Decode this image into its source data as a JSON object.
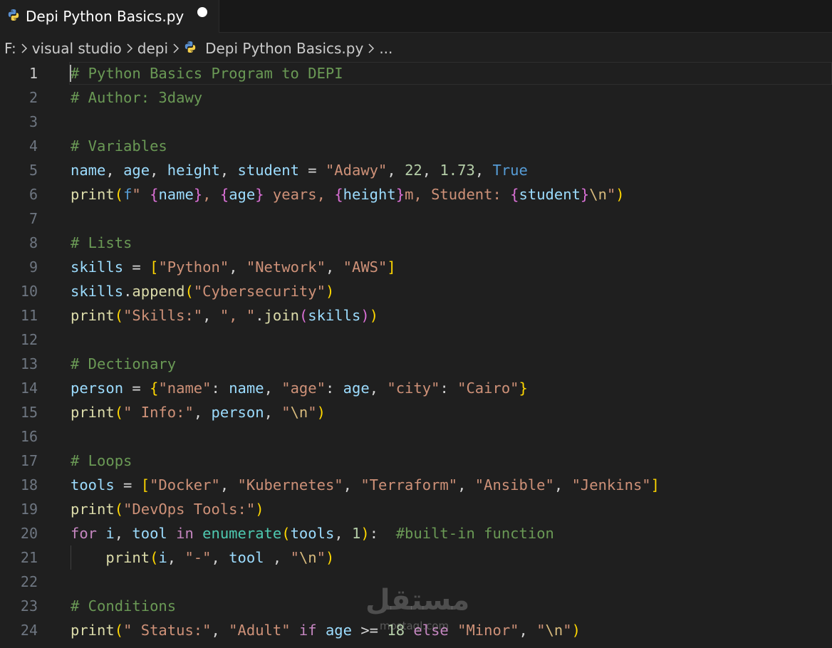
{
  "tab": {
    "label": "Depi Python Basics.py",
    "icon": "python-icon",
    "modified": true
  },
  "breadcrumb": {
    "drive": "F:",
    "folder1": "visual studio",
    "folder2": "depi",
    "file": "Depi Python Basics.py",
    "more": "..."
  },
  "editor": {
    "active_line": 1,
    "lines": [
      {
        "num": "1",
        "tokens": [
          {
            "t": "# Python Basics Program to DEPI",
            "c": "c"
          }
        ]
      },
      {
        "num": "2",
        "tokens": [
          {
            "t": "# Author: 3dawy",
            "c": "c"
          }
        ]
      },
      {
        "num": "3",
        "tokens": []
      },
      {
        "num": "4",
        "tokens": [
          {
            "t": "# Variables",
            "c": "c"
          }
        ]
      },
      {
        "num": "5",
        "tokens": [
          {
            "t": "name",
            "c": "v"
          },
          {
            "t": ", ",
            "c": "p"
          },
          {
            "t": "age",
            "c": "v"
          },
          {
            "t": ", ",
            "c": "p"
          },
          {
            "t": "height",
            "c": "v"
          },
          {
            "t": ", ",
            "c": "p"
          },
          {
            "t": "student",
            "c": "v"
          },
          {
            "t": " = ",
            "c": "p"
          },
          {
            "t": "\"Adawy\"",
            "c": "s"
          },
          {
            "t": ", ",
            "c": "p"
          },
          {
            "t": "22",
            "c": "n"
          },
          {
            "t": ", ",
            "c": "p"
          },
          {
            "t": "1.73",
            "c": "n"
          },
          {
            "t": ", ",
            "c": "p"
          },
          {
            "t": "True",
            "c": "k"
          }
        ]
      },
      {
        "num": "6",
        "tokens": [
          {
            "t": "print",
            "c": "f"
          },
          {
            "t": "(",
            "c": "b1"
          },
          {
            "t": "f",
            "c": "k"
          },
          {
            "t": "\" ",
            "c": "s"
          },
          {
            "t": "{",
            "c": "b2"
          },
          {
            "t": "name",
            "c": "v"
          },
          {
            "t": "}",
            "c": "b2"
          },
          {
            "t": ", ",
            "c": "s"
          },
          {
            "t": "{",
            "c": "b2"
          },
          {
            "t": "age",
            "c": "v"
          },
          {
            "t": "}",
            "c": "b2"
          },
          {
            "t": " years, ",
            "c": "s"
          },
          {
            "t": "{",
            "c": "b2"
          },
          {
            "t": "height",
            "c": "v"
          },
          {
            "t": "}",
            "c": "b2"
          },
          {
            "t": "m, Student: ",
            "c": "s"
          },
          {
            "t": "{",
            "c": "b2"
          },
          {
            "t": "student",
            "c": "v"
          },
          {
            "t": "}",
            "c": "b2"
          },
          {
            "t": "\\n",
            "c": "esc"
          },
          {
            "t": "\"",
            "c": "s"
          },
          {
            "t": ")",
            "c": "b1"
          }
        ]
      },
      {
        "num": "7",
        "tokens": []
      },
      {
        "num": "8",
        "tokens": [
          {
            "t": "# Lists",
            "c": "c"
          }
        ]
      },
      {
        "num": "9",
        "tokens": [
          {
            "t": "skills",
            "c": "v"
          },
          {
            "t": " = ",
            "c": "p"
          },
          {
            "t": "[",
            "c": "b1"
          },
          {
            "t": "\"Python\"",
            "c": "s"
          },
          {
            "t": ", ",
            "c": "p"
          },
          {
            "t": "\"Network\"",
            "c": "s"
          },
          {
            "t": ", ",
            "c": "p"
          },
          {
            "t": "\"AWS\"",
            "c": "s"
          },
          {
            "t": "]",
            "c": "b1"
          }
        ]
      },
      {
        "num": "10",
        "tokens": [
          {
            "t": "skills",
            "c": "v"
          },
          {
            "t": ".",
            "c": "p"
          },
          {
            "t": "append",
            "c": "f"
          },
          {
            "t": "(",
            "c": "b1"
          },
          {
            "t": "\"Cybersecurity\"",
            "c": "s"
          },
          {
            "t": ")",
            "c": "b1"
          }
        ]
      },
      {
        "num": "11",
        "tokens": [
          {
            "t": "print",
            "c": "f"
          },
          {
            "t": "(",
            "c": "b1"
          },
          {
            "t": "\"Skills:\"",
            "c": "s"
          },
          {
            "t": ", ",
            "c": "p"
          },
          {
            "t": "\", \"",
            "c": "s"
          },
          {
            "t": ".",
            "c": "p"
          },
          {
            "t": "join",
            "c": "f"
          },
          {
            "t": "(",
            "c": "b2"
          },
          {
            "t": "skills",
            "c": "v"
          },
          {
            "t": ")",
            "c": "b2"
          },
          {
            "t": ")",
            "c": "b1"
          }
        ]
      },
      {
        "num": "12",
        "tokens": []
      },
      {
        "num": "13",
        "tokens": [
          {
            "t": "# Dectionary",
            "c": "c"
          }
        ]
      },
      {
        "num": "14",
        "tokens": [
          {
            "t": "person",
            "c": "v"
          },
          {
            "t": " = ",
            "c": "p"
          },
          {
            "t": "{",
            "c": "b1"
          },
          {
            "t": "\"name\"",
            "c": "s"
          },
          {
            "t": ": ",
            "c": "p"
          },
          {
            "t": "name",
            "c": "v"
          },
          {
            "t": ", ",
            "c": "p"
          },
          {
            "t": "\"age\"",
            "c": "s"
          },
          {
            "t": ": ",
            "c": "p"
          },
          {
            "t": "age",
            "c": "v"
          },
          {
            "t": ", ",
            "c": "p"
          },
          {
            "t": "\"city\"",
            "c": "s"
          },
          {
            "t": ": ",
            "c": "p"
          },
          {
            "t": "\"Cairo\"",
            "c": "s"
          },
          {
            "t": "}",
            "c": "b1"
          }
        ]
      },
      {
        "num": "15",
        "tokens": [
          {
            "t": "print",
            "c": "f"
          },
          {
            "t": "(",
            "c": "b1"
          },
          {
            "t": "\" Info:\"",
            "c": "s"
          },
          {
            "t": ", ",
            "c": "p"
          },
          {
            "t": "person",
            "c": "v"
          },
          {
            "t": ", ",
            "c": "p"
          },
          {
            "t": "\"",
            "c": "s"
          },
          {
            "t": "\\n",
            "c": "esc"
          },
          {
            "t": "\"",
            "c": "s"
          },
          {
            "t": ")",
            "c": "b1"
          }
        ]
      },
      {
        "num": "16",
        "tokens": []
      },
      {
        "num": "17",
        "tokens": [
          {
            "t": "# Loops",
            "c": "c"
          }
        ]
      },
      {
        "num": "18",
        "tokens": [
          {
            "t": "tools",
            "c": "v"
          },
          {
            "t": " = ",
            "c": "p"
          },
          {
            "t": "[",
            "c": "b1"
          },
          {
            "t": "\"Docker\"",
            "c": "s"
          },
          {
            "t": ", ",
            "c": "p"
          },
          {
            "t": "\"Kubernetes\"",
            "c": "s"
          },
          {
            "t": ", ",
            "c": "p"
          },
          {
            "t": "\"Terraform\"",
            "c": "s"
          },
          {
            "t": ", ",
            "c": "p"
          },
          {
            "t": "\"Ansible\"",
            "c": "s"
          },
          {
            "t": ", ",
            "c": "p"
          },
          {
            "t": "\"Jenkins\"",
            "c": "s"
          },
          {
            "t": "]",
            "c": "b1"
          }
        ]
      },
      {
        "num": "19",
        "tokens": [
          {
            "t": "print",
            "c": "f"
          },
          {
            "t": "(",
            "c": "b1"
          },
          {
            "t": "\"DevOps Tools:\"",
            "c": "s"
          },
          {
            "t": ")",
            "c": "b1"
          }
        ]
      },
      {
        "num": "20",
        "tokens": [
          {
            "t": "for",
            "c": "cf"
          },
          {
            "t": " ",
            "c": "p"
          },
          {
            "t": "i",
            "c": "v"
          },
          {
            "t": ", ",
            "c": "p"
          },
          {
            "t": "tool",
            "c": "v"
          },
          {
            "t": " ",
            "c": "p"
          },
          {
            "t": "in",
            "c": "cf"
          },
          {
            "t": " ",
            "c": "p"
          },
          {
            "t": "enumerate",
            "c": "cls"
          },
          {
            "t": "(",
            "c": "b1"
          },
          {
            "t": "tools",
            "c": "v"
          },
          {
            "t": ", ",
            "c": "p"
          },
          {
            "t": "1",
            "c": "n"
          },
          {
            "t": ")",
            "c": "b1"
          },
          {
            "t": ":  ",
            "c": "p"
          },
          {
            "t": "#built-in function",
            "c": "c"
          }
        ]
      },
      {
        "num": "21",
        "indent": true,
        "tokens": [
          {
            "t": "    ",
            "c": "p"
          },
          {
            "t": "print",
            "c": "f"
          },
          {
            "t": "(",
            "c": "b1"
          },
          {
            "t": "i",
            "c": "v"
          },
          {
            "t": ", ",
            "c": "p"
          },
          {
            "t": "\"-\"",
            "c": "s"
          },
          {
            "t": ", ",
            "c": "p"
          },
          {
            "t": "tool",
            "c": "v"
          },
          {
            "t": " , ",
            "c": "p"
          },
          {
            "t": "\"",
            "c": "s"
          },
          {
            "t": "\\n",
            "c": "esc"
          },
          {
            "t": "\"",
            "c": "s"
          },
          {
            "t": ")",
            "c": "b1"
          }
        ]
      },
      {
        "num": "22",
        "tokens": []
      },
      {
        "num": "23",
        "tokens": [
          {
            "t": "# Conditions",
            "c": "c"
          }
        ]
      },
      {
        "num": "24",
        "tokens": [
          {
            "t": "print",
            "c": "f"
          },
          {
            "t": "(",
            "c": "b1"
          },
          {
            "t": "\" Status:\"",
            "c": "s"
          },
          {
            "t": ", ",
            "c": "p"
          },
          {
            "t": "\"Adult\"",
            "c": "s"
          },
          {
            "t": " ",
            "c": "p"
          },
          {
            "t": "if",
            "c": "cf"
          },
          {
            "t": " ",
            "c": "p"
          },
          {
            "t": "age",
            "c": "v"
          },
          {
            "t": " >= ",
            "c": "p"
          },
          {
            "t": "18",
            "c": "n"
          },
          {
            "t": " ",
            "c": "p"
          },
          {
            "t": "else",
            "c": "cf"
          },
          {
            "t": " ",
            "c": "p"
          },
          {
            "t": "\"Minor\"",
            "c": "s"
          },
          {
            "t": ", ",
            "c": "p"
          },
          {
            "t": "\"",
            "c": "s"
          },
          {
            "t": "\\n",
            "c": "esc"
          },
          {
            "t": "\"",
            "c": "s"
          },
          {
            "t": ")",
            "c": "b1"
          }
        ]
      }
    ]
  },
  "watermark": {
    "arabic": "مستقل",
    "latin": "mostaql.com"
  }
}
